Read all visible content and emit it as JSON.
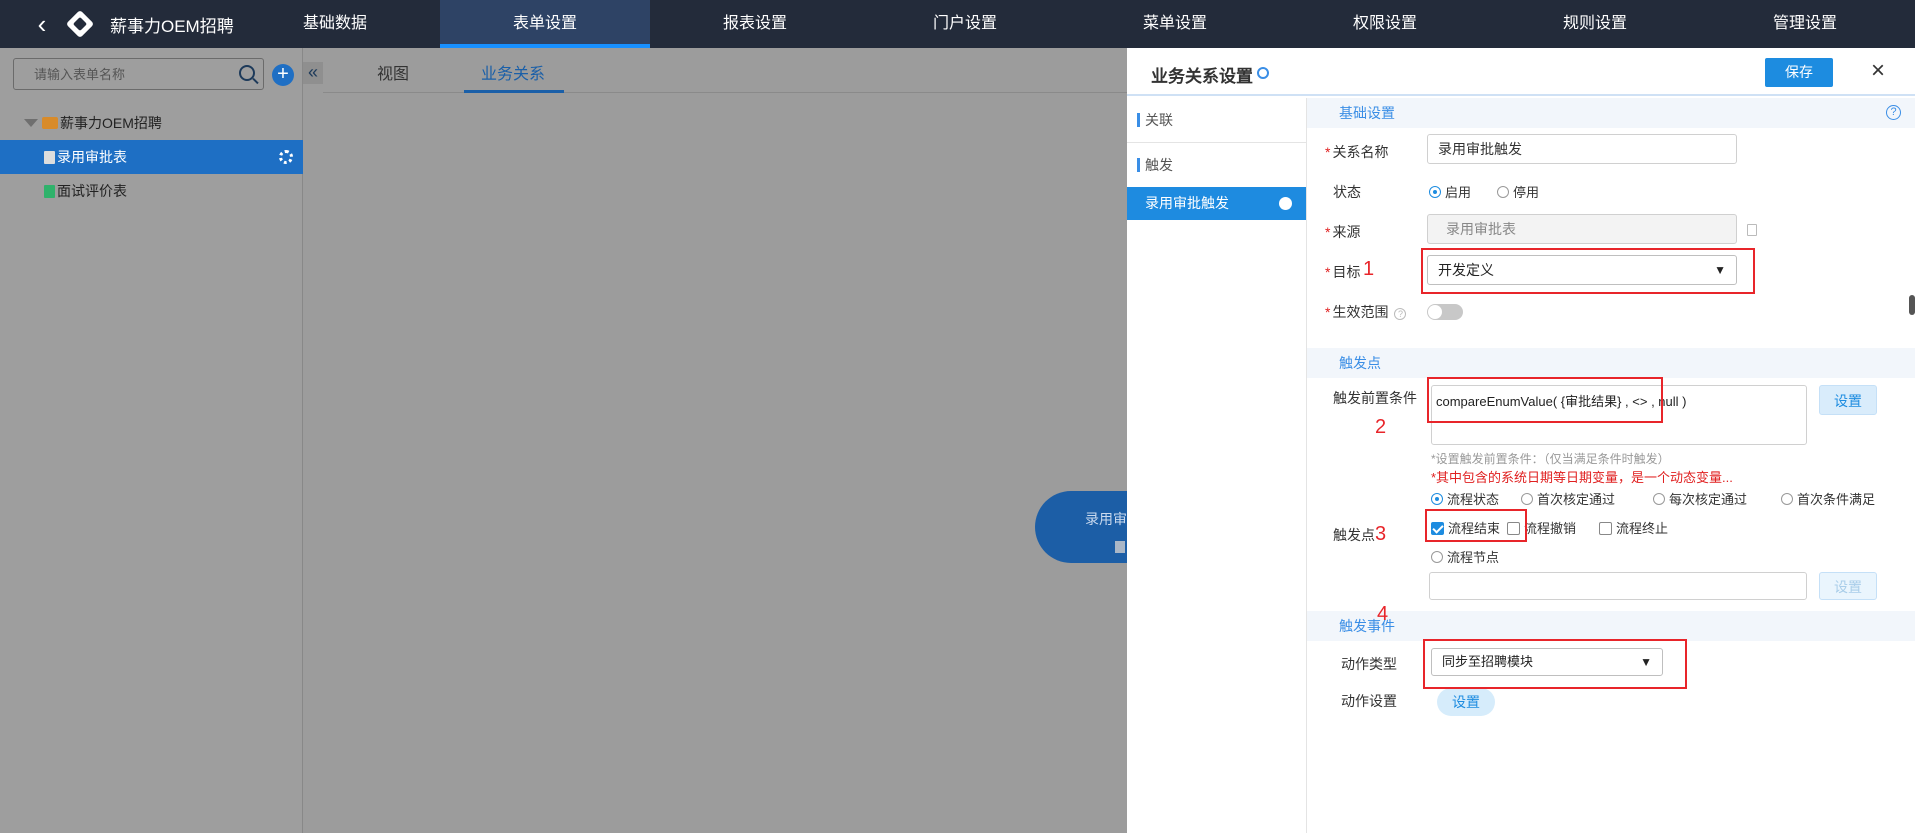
{
  "topbar": {
    "app_title": "薪事力OEM招聘",
    "nav": [
      "基础数据",
      "表单设置",
      "报表设置",
      "门户设置",
      "菜单设置",
      "权限设置",
      "规则设置",
      "管理设置"
    ],
    "active_nav": "表单设置"
  },
  "sidebar": {
    "search_placeholder": "请输入表单名称",
    "tree": {
      "root": "薪事力OEM招聘",
      "items": [
        "录用审批表",
        "面试评价表"
      ],
      "selected": "录用审批表"
    }
  },
  "center": {
    "tabs": [
      "视图",
      "业务关系"
    ],
    "active_tab": "业务关系",
    "node_label": "录用审"
  },
  "drawer": {
    "title": "业务关系设置",
    "save_label": "保存",
    "relation_sections": {
      "link": "关联",
      "trigger": "触发",
      "selected_item": "录用审批触发"
    },
    "basic": {
      "section_title": "基础设置",
      "name_label": "关系名称",
      "name_value": "录用审批触发",
      "status_label": "状态",
      "status_options": [
        "启用",
        "停用"
      ],
      "status_selected": "启用",
      "source_label": "来源",
      "source_value": "录用审批表",
      "target_label": "目标",
      "target_value": "开发定义",
      "scope_label": "生效范围",
      "scope_enabled": false
    },
    "trigger_point": {
      "section_title": "触发点",
      "precondition_label": "触发前置条件",
      "precondition_value": "compareEnumValue( {审批结果} , <> , null )",
      "set_label": "设置",
      "hint": "*设置触发前置条件：（仅当满足条件时触发）",
      "warning": "*其中包含的系统日期等日期变量，是一个动态变量...",
      "point_label": "触发点",
      "mode_options": [
        "流程状态",
        "首次核定通过",
        "每次核定通过",
        "首次条件满足"
      ],
      "mode_selected": "流程状态",
      "flow_checks": [
        {
          "label": "流程结束",
          "checked": true
        },
        {
          "label": "流程撤销",
          "checked": false
        },
        {
          "label": "流程终止",
          "checked": false
        }
      ],
      "node_option": "流程节点",
      "node_set_label": "设置"
    },
    "trigger_event": {
      "section_title": "触发事件",
      "action_type_label": "动作类型",
      "action_type_value": "同步至招聘模块",
      "action_setting_label": "动作设置",
      "action_setting_button": "设置"
    },
    "annotations": [
      "1",
      "2",
      "3",
      "4"
    ],
    "colors": {
      "accent": "#1d8ce0",
      "annotation": "#e8252a",
      "topbar": "#232b3a"
    }
  }
}
